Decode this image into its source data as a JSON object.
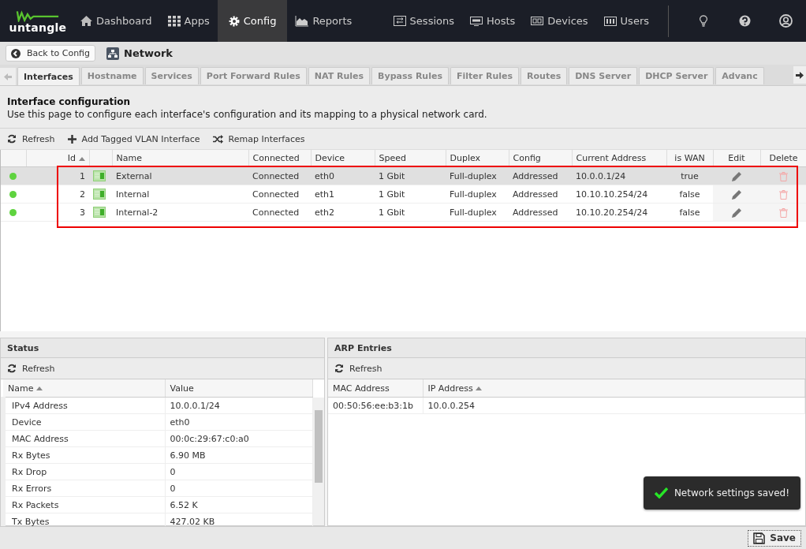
{
  "nav": {
    "logo": "untangle",
    "items": [
      {
        "label": "Dashboard",
        "selected": false
      },
      {
        "label": "Apps",
        "selected": false
      },
      {
        "label": "Config",
        "selected": true
      },
      {
        "label": "Reports",
        "selected": false
      }
    ],
    "right_items": [
      {
        "label": "Sessions"
      },
      {
        "label": "Hosts"
      },
      {
        "label": "Devices"
      },
      {
        "label": "Users"
      }
    ]
  },
  "header": {
    "back_button": "Back to Config",
    "title": "Network"
  },
  "tabs": [
    {
      "label": "Interfaces",
      "selected": true
    },
    {
      "label": "Hostname",
      "selected": false
    },
    {
      "label": "Services",
      "selected": false
    },
    {
      "label": "Port Forward Rules",
      "selected": false
    },
    {
      "label": "NAT Rules",
      "selected": false
    },
    {
      "label": "Bypass Rules",
      "selected": false
    },
    {
      "label": "Filter Rules",
      "selected": false
    },
    {
      "label": "Routes",
      "selected": false
    },
    {
      "label": "DNS Server",
      "selected": false
    },
    {
      "label": "DHCP Server",
      "selected": false
    },
    {
      "label": "Advanc",
      "selected": false
    }
  ],
  "intro": {
    "title": "Interface configuration",
    "description": "Use this page to configure each interface's configuration and its mapping to a physical network card."
  },
  "toolbar": [
    "Refresh",
    "Add Tagged VLAN Interface",
    "Remap Interfaces"
  ],
  "table": {
    "columns": [
      "Id",
      "Name",
      "Connected",
      "Device",
      "Speed",
      "Duplex",
      "Config",
      "Current Address",
      "is WAN",
      "Edit",
      "Delete"
    ],
    "rows": [
      {
        "selected": true,
        "color": "#5fd33f",
        "id": "1",
        "name": "External",
        "connected": "Connected",
        "device": "eth0",
        "speed": "1 Gbit",
        "duplex": "Full-duplex",
        "config": "Addressed",
        "address": "10.0.0.1/24",
        "is_wan": "true"
      },
      {
        "selected": false,
        "color": "#5fd33f",
        "id": "2",
        "name": "Internal",
        "connected": "Connected",
        "device": "eth1",
        "speed": "1 Gbit",
        "duplex": "Full-duplex",
        "config": "Addressed",
        "address": "10.10.10.254/24",
        "is_wan": "false"
      },
      {
        "selected": false,
        "color": "#5fd33f",
        "id": "3",
        "name": "Internal-2",
        "connected": "Connected",
        "device": "eth2",
        "speed": "1 Gbit",
        "duplex": "Full-duplex",
        "config": "Addressed",
        "address": "10.10.20.254/24",
        "is_wan": "false"
      }
    ]
  },
  "status": {
    "title": "Status",
    "refresh": "Refresh",
    "columns": [
      "Name",
      "Value"
    ],
    "rows": [
      {
        "name": "IPv4 Address",
        "value": "10.0.0.1/24"
      },
      {
        "name": "Device",
        "value": "eth0"
      },
      {
        "name": "MAC Address",
        "value": "00:0c:29:67:c0:a0"
      },
      {
        "name": "Rx Bytes",
        "value": "6.90 MB"
      },
      {
        "name": "Rx Drop",
        "value": "0"
      },
      {
        "name": "Rx Errors",
        "value": "0"
      },
      {
        "name": "Rx Packets",
        "value": "6.52 K"
      },
      {
        "name": "Tx Bytes",
        "value": "427.02 KB"
      }
    ]
  },
  "arp": {
    "title": "ARP Entries",
    "refresh": "Refresh",
    "columns": [
      "MAC Address",
      "IP Address"
    ],
    "rows": [
      {
        "mac": "00:50:56:ee:b3:1b",
        "ip": "10.0.0.254"
      }
    ]
  },
  "toast": "Network settings saved!",
  "save_button": "Save"
}
